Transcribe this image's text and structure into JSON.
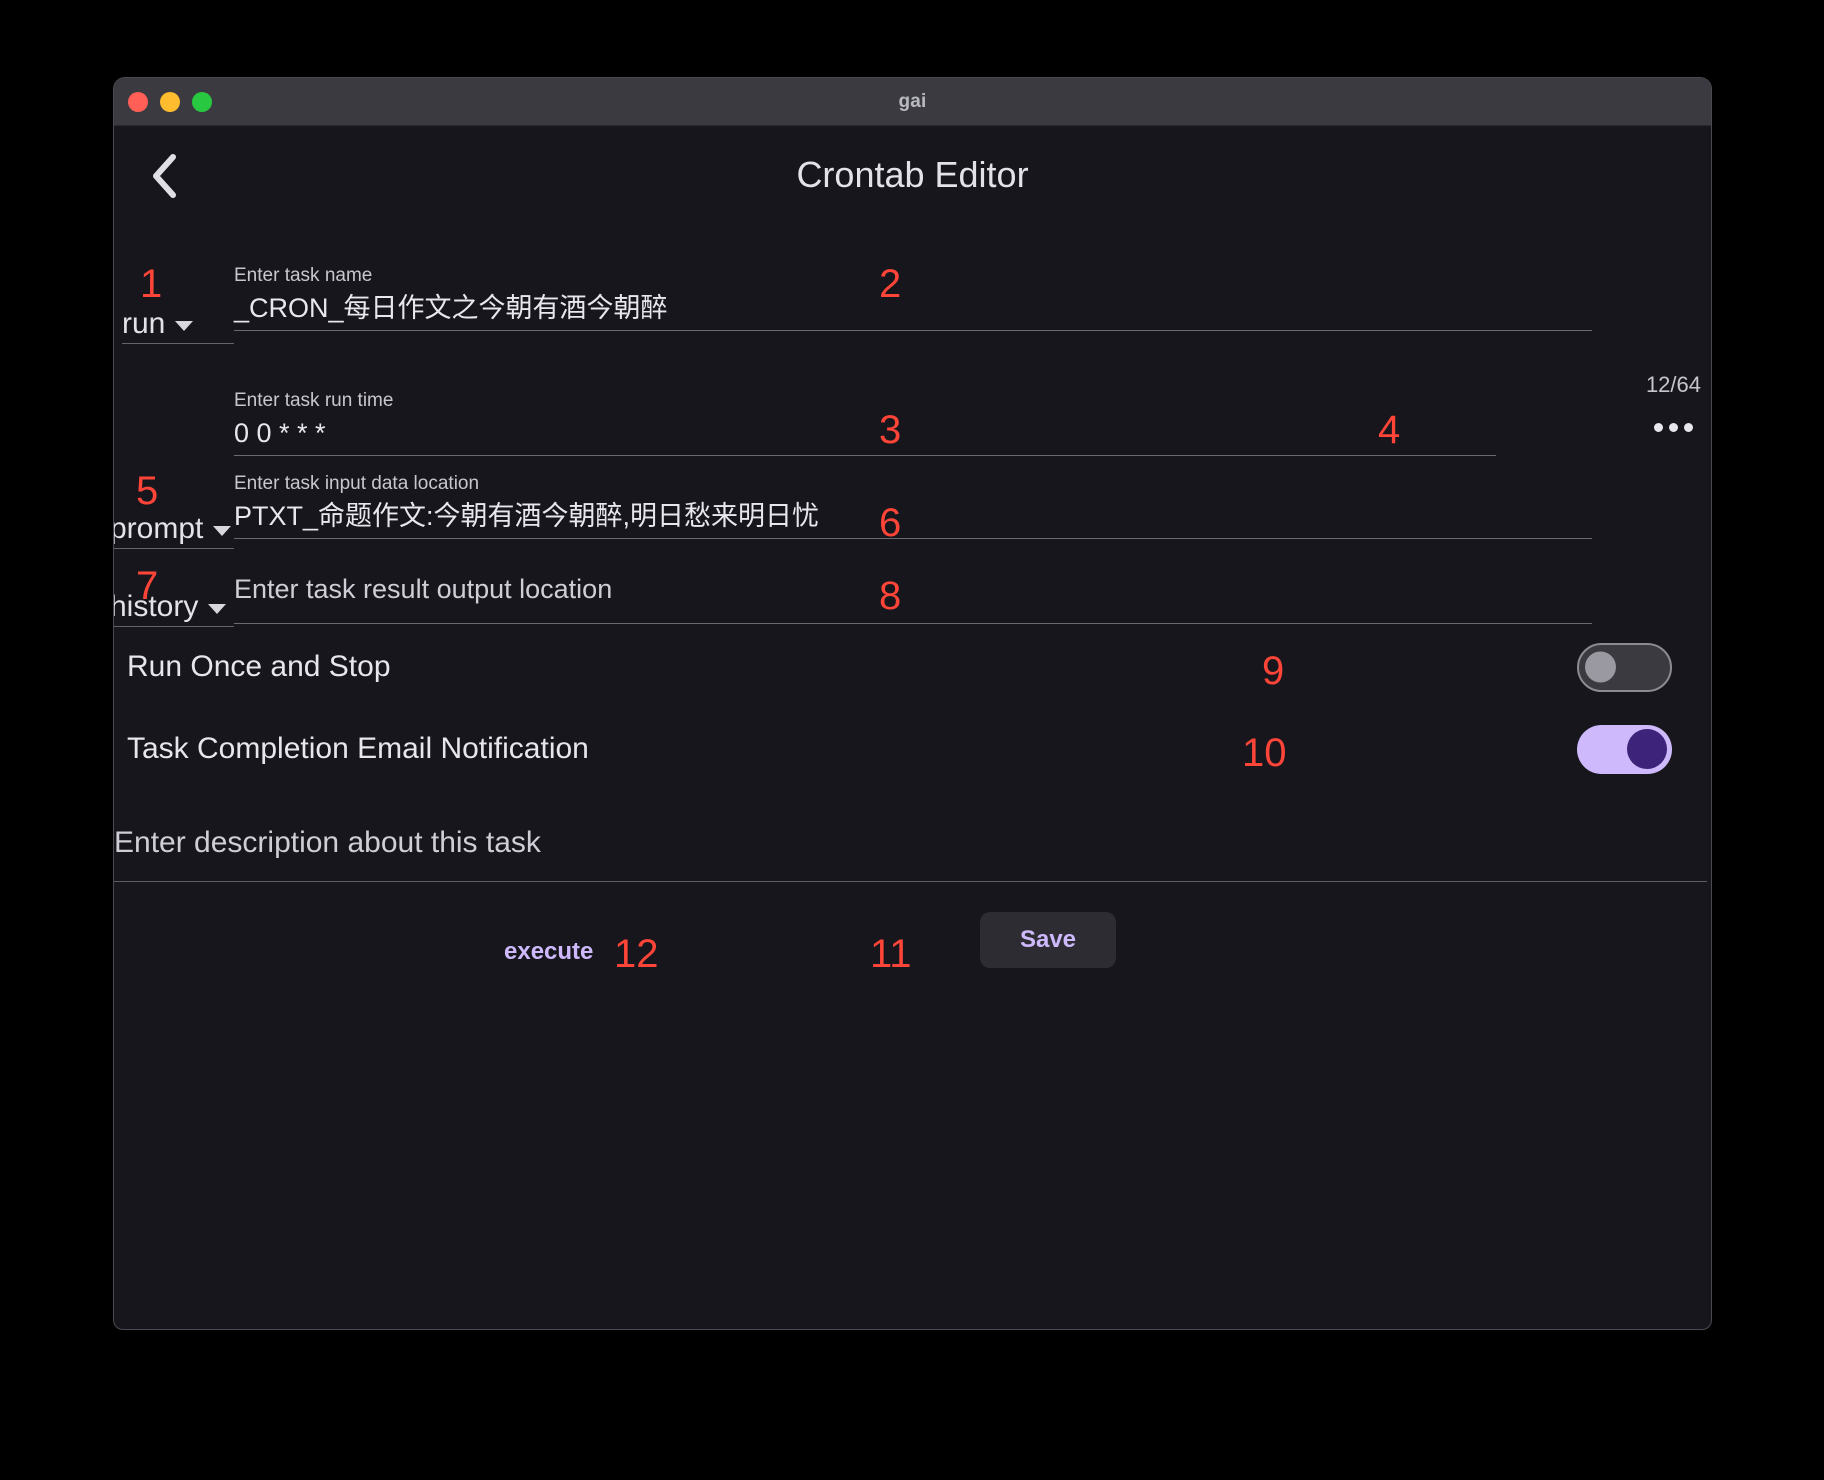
{
  "window": {
    "title": "gai",
    "traffic_lights": [
      "close-button",
      "minimize-button",
      "maximize-button"
    ]
  },
  "header": {
    "back_icon": "chevron-left-icon",
    "title": "Crontab Editor"
  },
  "annotations": {
    "n1": "1",
    "n2": "2",
    "n3": "3",
    "n4": "4",
    "n5": "5",
    "n6": "6",
    "n7": "7",
    "n8": "8",
    "n9": "9",
    "n10": "10",
    "n11": "11",
    "n12": "12",
    "color": "#FF4438"
  },
  "form": {
    "type_dropdown": {
      "value": "run",
      "icon": "chevron-down-icon"
    },
    "task_name": {
      "label": "Enter task name",
      "value": "_CRON_每日作文之今朝有酒今朝醉",
      "counter": "12/64"
    },
    "run_time": {
      "label": "Enter task run time",
      "value": "0 0 * * *",
      "more_icon": "ellipsis-icon"
    },
    "input_dropdown": {
      "value": "prompt",
      "icon": "chevron-down-icon"
    },
    "input_location": {
      "label": "Enter task input data location",
      "value": "PTXT_命题作文:今朝有酒今朝醉,明日愁来明日忧"
    },
    "output_dropdown": {
      "value": "history",
      "icon": "chevron-down-icon"
    },
    "output_location": {
      "placeholder": "Enter task result output location",
      "value": ""
    },
    "description": {
      "placeholder": "Enter description about this task",
      "value": ""
    }
  },
  "toggles": [
    {
      "label": "Run Once and Stop",
      "state": "off"
    },
    {
      "label": "Task Completion Email Notification",
      "state": "on"
    }
  ],
  "footer": {
    "execute_label": "execute",
    "save_label": "Save"
  },
  "colors": {
    "accent_purple": "#CDB9FB",
    "toggle_on_track": "#CDB9FB",
    "toggle_on_knob": "#3D2379",
    "annotation_red": "#FF4438",
    "window_bg": "#17161C",
    "titlebar_bg": "#3A3A40"
  }
}
